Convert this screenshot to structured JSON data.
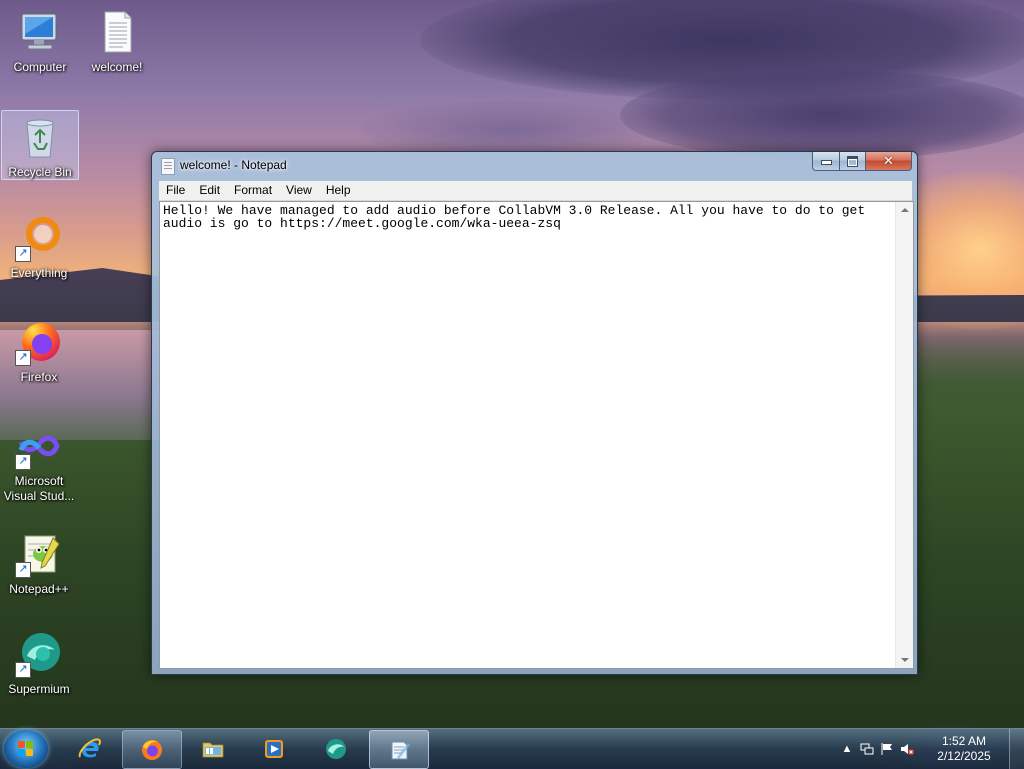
{
  "desktop": {
    "icons": [
      {
        "label": "Computer"
      },
      {
        "label": "welcome!"
      },
      {
        "label": "Recycle Bin"
      },
      {
        "label": "Everything"
      },
      {
        "label": "Firefox"
      },
      {
        "label": "Microsoft Visual Stud..."
      },
      {
        "label": "Notepad++"
      },
      {
        "label": "Supermium"
      }
    ]
  },
  "notepad": {
    "title": "welcome! - Notepad",
    "menu": [
      "File",
      "Edit",
      "Format",
      "View",
      "Help"
    ],
    "content": "Hello! We have managed to add audio before CollabVM 3.0 Release. All you have to do to get audio is go to https://meet.google.com/wka-ueea-zsq",
    "buttons": {
      "minimize": "minimize",
      "maximize": "maximize",
      "close": "close"
    }
  },
  "taskbar": {
    "items": [
      {
        "name": "Internet Explorer",
        "icon": "internet-explorer-icon"
      },
      {
        "name": "Firefox",
        "icon": "firefox-icon"
      },
      {
        "name": "Windows Explorer",
        "icon": "folder-icon"
      },
      {
        "name": "Windows Media Player",
        "icon": "media-player-icon"
      },
      {
        "name": "Supermium",
        "icon": "supermium-icon"
      },
      {
        "name": "Notepad",
        "icon": "notepad-icon"
      }
    ],
    "clock": {
      "time": "1:52 AM",
      "date": "2/12/2025"
    },
    "tray": {
      "volume_muted": true
    }
  }
}
